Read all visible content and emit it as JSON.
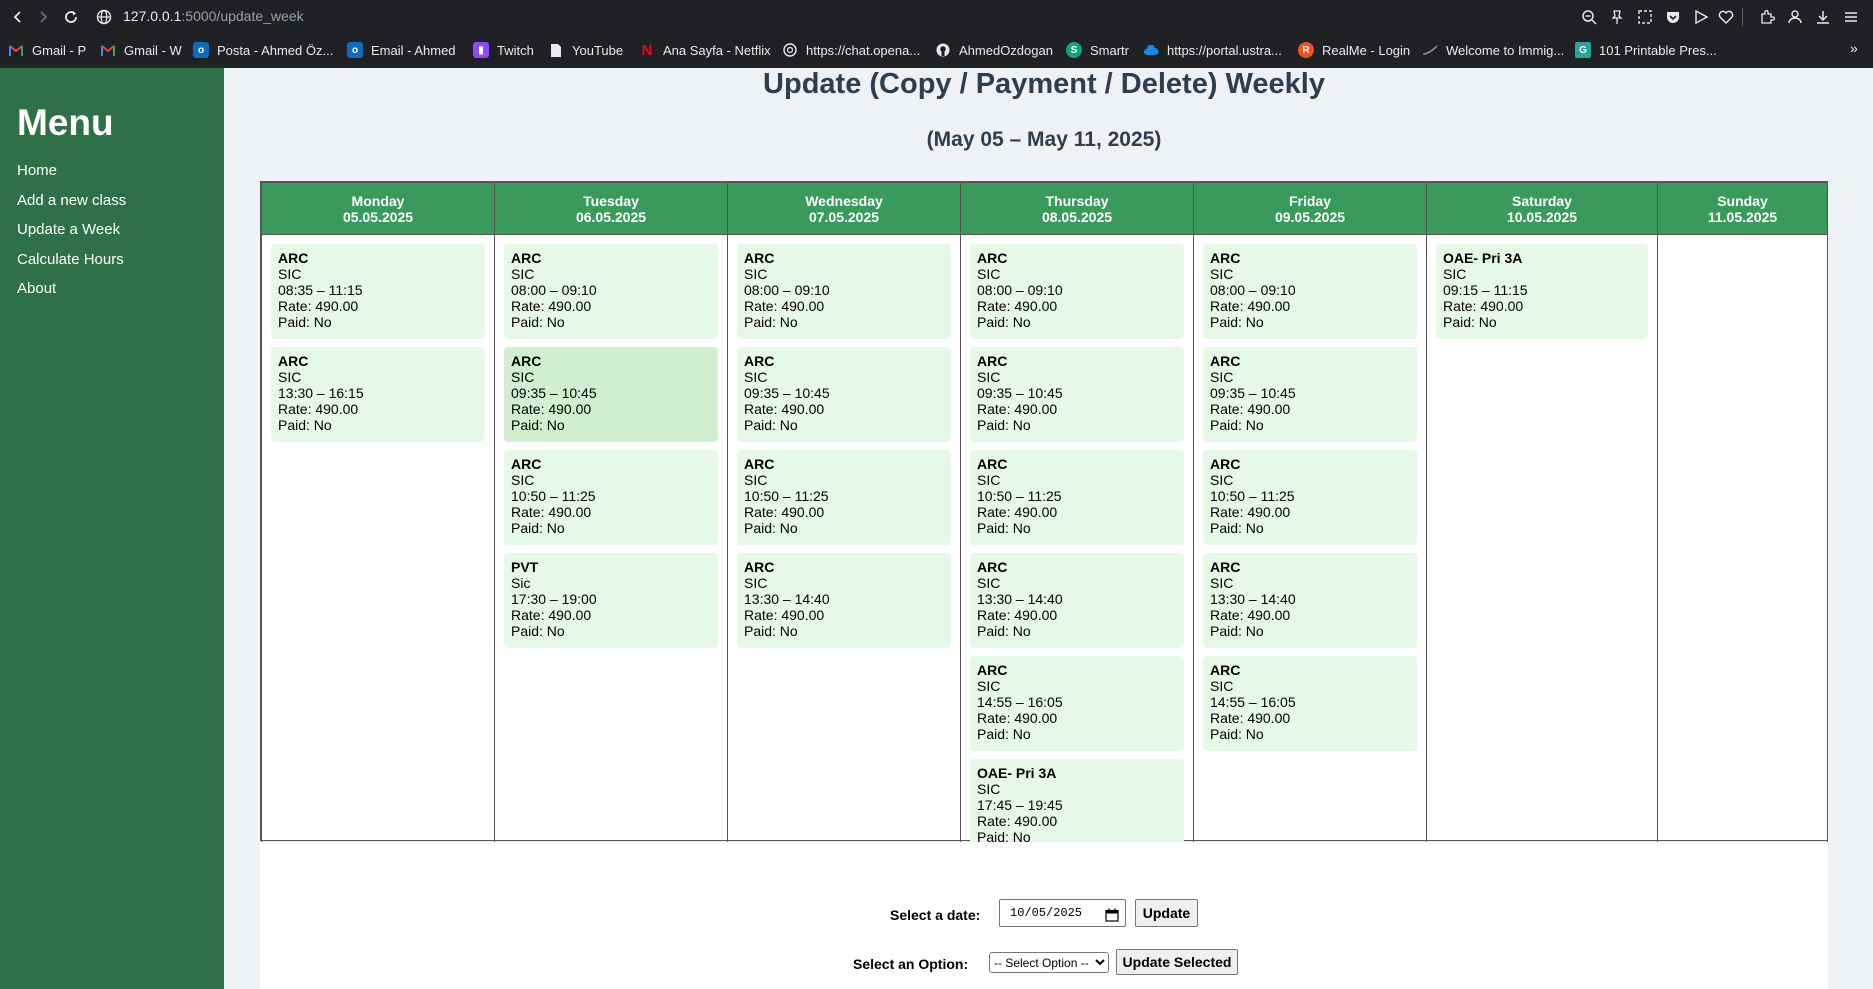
{
  "browser": {
    "url_host": "127.0.0.1",
    "url_rest": ":5000/update_week",
    "bookmarks": [
      {
        "label": "Gmail - P",
        "icon": "gmail-icon",
        "color": "#ea4335"
      },
      {
        "label": "Gmail - W",
        "icon": "gmail-icon",
        "color": "#ea4335"
      },
      {
        "label": "Posta - Ahmed Öz...",
        "icon": "outlook-icon",
        "color": "#0f6cbd"
      },
      {
        "label": "Email - Ahmed",
        "icon": "outlook-icon",
        "color": "#0f6cbd"
      },
      {
        "label": "Twitch",
        "icon": "twitch-icon",
        "color": "#9146ff"
      },
      {
        "label": "YouTube",
        "icon": "document-icon",
        "color": "#e8eaed"
      },
      {
        "label": "Ana Sayfa - Netflix",
        "icon": "netflix-icon",
        "color": "#e50914"
      },
      {
        "label": "https://chat.opena...",
        "icon": "openai-icon",
        "color": "#e8eaed"
      },
      {
        "label": "AhmedOzdogan",
        "icon": "github-icon",
        "color": "#e8eaed"
      },
      {
        "label": "Smartr",
        "icon": "smartr-icon",
        "color": "#10a37f"
      },
      {
        "label": "https://portal.ustra...",
        "icon": "cloud-icon",
        "color": "#1e88e5"
      },
      {
        "label": "RealMe - Login",
        "icon": "realme-icon",
        "color": "#f4511e"
      },
      {
        "label": "Welcome to Immig...",
        "icon": "fern-icon",
        "color": "#8a8a8a"
      },
      {
        "label": "101 Printable Pres...",
        "icon": "printable-icon",
        "color": "#26a69a"
      }
    ]
  },
  "sidebar": {
    "title": "Menu",
    "items": [
      {
        "label": "Home"
      },
      {
        "label": "Add a new class"
      },
      {
        "label": "Update a Week"
      },
      {
        "label": "Calculate Hours"
      },
      {
        "label": "About"
      }
    ]
  },
  "main": {
    "title": "Update (Copy / Payment / Delete) Weekly",
    "week_range": "(May 05 – May 11, 2025)"
  },
  "week": {
    "days": [
      {
        "name": "Monday",
        "date": "05.05.2025",
        "classes": [
          {
            "name": "ARC",
            "school": "SIC",
            "time": "08:35 – 11:15",
            "rate": "Rate: 490.00",
            "paid": "Paid: No"
          },
          {
            "name": "ARC",
            "school": "SIC",
            "time": "13:30 – 16:15",
            "rate": "Rate: 490.00",
            "paid": "Paid: No"
          }
        ]
      },
      {
        "name": "Tuesday",
        "date": "06.05.2025",
        "classes": [
          {
            "name": "ARC",
            "school": "SIC",
            "time": "08:00 – 09:10",
            "rate": "Rate: 490.00",
            "paid": "Paid: No"
          },
          {
            "name": "ARC",
            "school": "SIC",
            "time": "09:35 – 10:45",
            "rate": "Rate: 490.00",
            "paid": "Paid: No",
            "hovered": true
          },
          {
            "name": "ARC",
            "school": "SIC",
            "time": "10:50 – 11:25",
            "rate": "Rate: 490.00",
            "paid": "Paid: No"
          },
          {
            "name": "PVT",
            "school": "Sic",
            "time": "17:30 – 19:00",
            "rate": "Rate: 490.00",
            "paid": "Paid: No"
          }
        ]
      },
      {
        "name": "Wednesday",
        "date": "07.05.2025",
        "classes": [
          {
            "name": "ARC",
            "school": "SIC",
            "time": "08:00 – 09:10",
            "rate": "Rate: 490.00",
            "paid": "Paid: No"
          },
          {
            "name": "ARC",
            "school": "SIC",
            "time": "09:35 – 10:45",
            "rate": "Rate: 490.00",
            "paid": "Paid: No"
          },
          {
            "name": "ARC",
            "school": "SIC",
            "time": "10:50 – 11:25",
            "rate": "Rate: 490.00",
            "paid": "Paid: No"
          },
          {
            "name": "ARC",
            "school": "SIC",
            "time": "13:30 – 14:40",
            "rate": "Rate: 490.00",
            "paid": "Paid: No"
          }
        ]
      },
      {
        "name": "Thursday",
        "date": "08.05.2025",
        "classes": [
          {
            "name": "ARC",
            "school": "SIC",
            "time": "08:00 – 09:10",
            "rate": "Rate: 490.00",
            "paid": "Paid: No"
          },
          {
            "name": "ARC",
            "school": "SIC",
            "time": "09:35 – 10:45",
            "rate": "Rate: 490.00",
            "paid": "Paid: No"
          },
          {
            "name": "ARC",
            "school": "SIC",
            "time": "10:50 – 11:25",
            "rate": "Rate: 490.00",
            "paid": "Paid: No"
          },
          {
            "name": "ARC",
            "school": "SIC",
            "time": "13:30 – 14:40",
            "rate": "Rate: 490.00",
            "paid": "Paid: No"
          },
          {
            "name": "ARC",
            "school": "SIC",
            "time": "14:55 – 16:05",
            "rate": "Rate: 490.00",
            "paid": "Paid: No"
          },
          {
            "name": "OAE- Pri 3A",
            "school": "SIC",
            "time": "17:45 – 19:45",
            "rate": "Rate: 490.00",
            "paid": "Paid: No"
          }
        ]
      },
      {
        "name": "Friday",
        "date": "09.05.2025",
        "classes": [
          {
            "name": "ARC",
            "school": "SIC",
            "time": "08:00 – 09:10",
            "rate": "Rate: 490.00",
            "paid": "Paid: No"
          },
          {
            "name": "ARC",
            "school": "SIC",
            "time": "09:35 – 10:45",
            "rate": "Rate: 490.00",
            "paid": "Paid: No"
          },
          {
            "name": "ARC",
            "school": "SIC",
            "time": "10:50 – 11:25",
            "rate": "Rate: 490.00",
            "paid": "Paid: No"
          },
          {
            "name": "ARC",
            "school": "SIC",
            "time": "13:30 – 14:40",
            "rate": "Rate: 490.00",
            "paid": "Paid: No"
          },
          {
            "name": "ARC",
            "school": "SIC",
            "time": "14:55 – 16:05",
            "rate": "Rate: 490.00",
            "paid": "Paid: No"
          }
        ]
      },
      {
        "name": "Saturday",
        "date": "10.05.2025",
        "classes": [
          {
            "name": "OAE- Pri 3A",
            "school": "SIC",
            "time": "09:15 – 11:15",
            "rate": "Rate: 490.00",
            "paid": "Paid: No"
          }
        ]
      },
      {
        "name": "Sunday",
        "date": "11.05.2025",
        "classes": []
      }
    ]
  },
  "controls": {
    "date_label": "Select a date:",
    "date_value": "10/05/2025",
    "update_button": "Update",
    "option_label": "Select an Option:",
    "option_selected": "-- Select Option --",
    "update_selected_button": "Update Selected"
  }
}
